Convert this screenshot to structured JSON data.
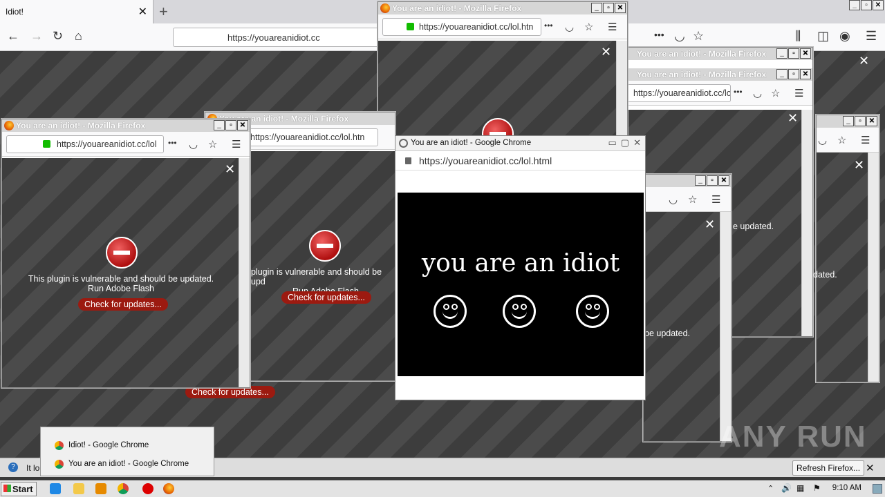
{
  "main_browser": {
    "tab_title": "Idiot!",
    "url": "https://youareanidiot.cc"
  },
  "popups": {
    "ff_title": "You are an idiot! - Mozilla Firefox",
    "ff_url": "https://youareanidiot.cc/lol",
    "ff_url_html": "https://youareanidiot.cc/lol.htn",
    "plugin_line1": "This plugin is vulnerable and should be updated.",
    "plugin_line2": "Run Adobe Flash",
    "plugin_line1_cut": "plugin is vulnerable and should be upd",
    "check_updates": "Check for updates...",
    "updated_fragment": "e updated.",
    "updated_fragment2": "dated.",
    "updated_fragment3": "be updated."
  },
  "chrome_popup": {
    "title": "You are an idiot! - Google Chrome",
    "url": "https://youareanidiot.cc/lol.html",
    "headline": "you are an idiot"
  },
  "jumplist": {
    "items": [
      "Idiot! - Google Chrome",
      "You are an idiot! - Google Chrome"
    ]
  },
  "notification": {
    "text_fragment": "It lo",
    "refresh_label": "Refresh Firefox..."
  },
  "taskbar": {
    "start_label": "Start",
    "clock": "9:10 AM"
  },
  "watermark": "ANY RUN"
}
